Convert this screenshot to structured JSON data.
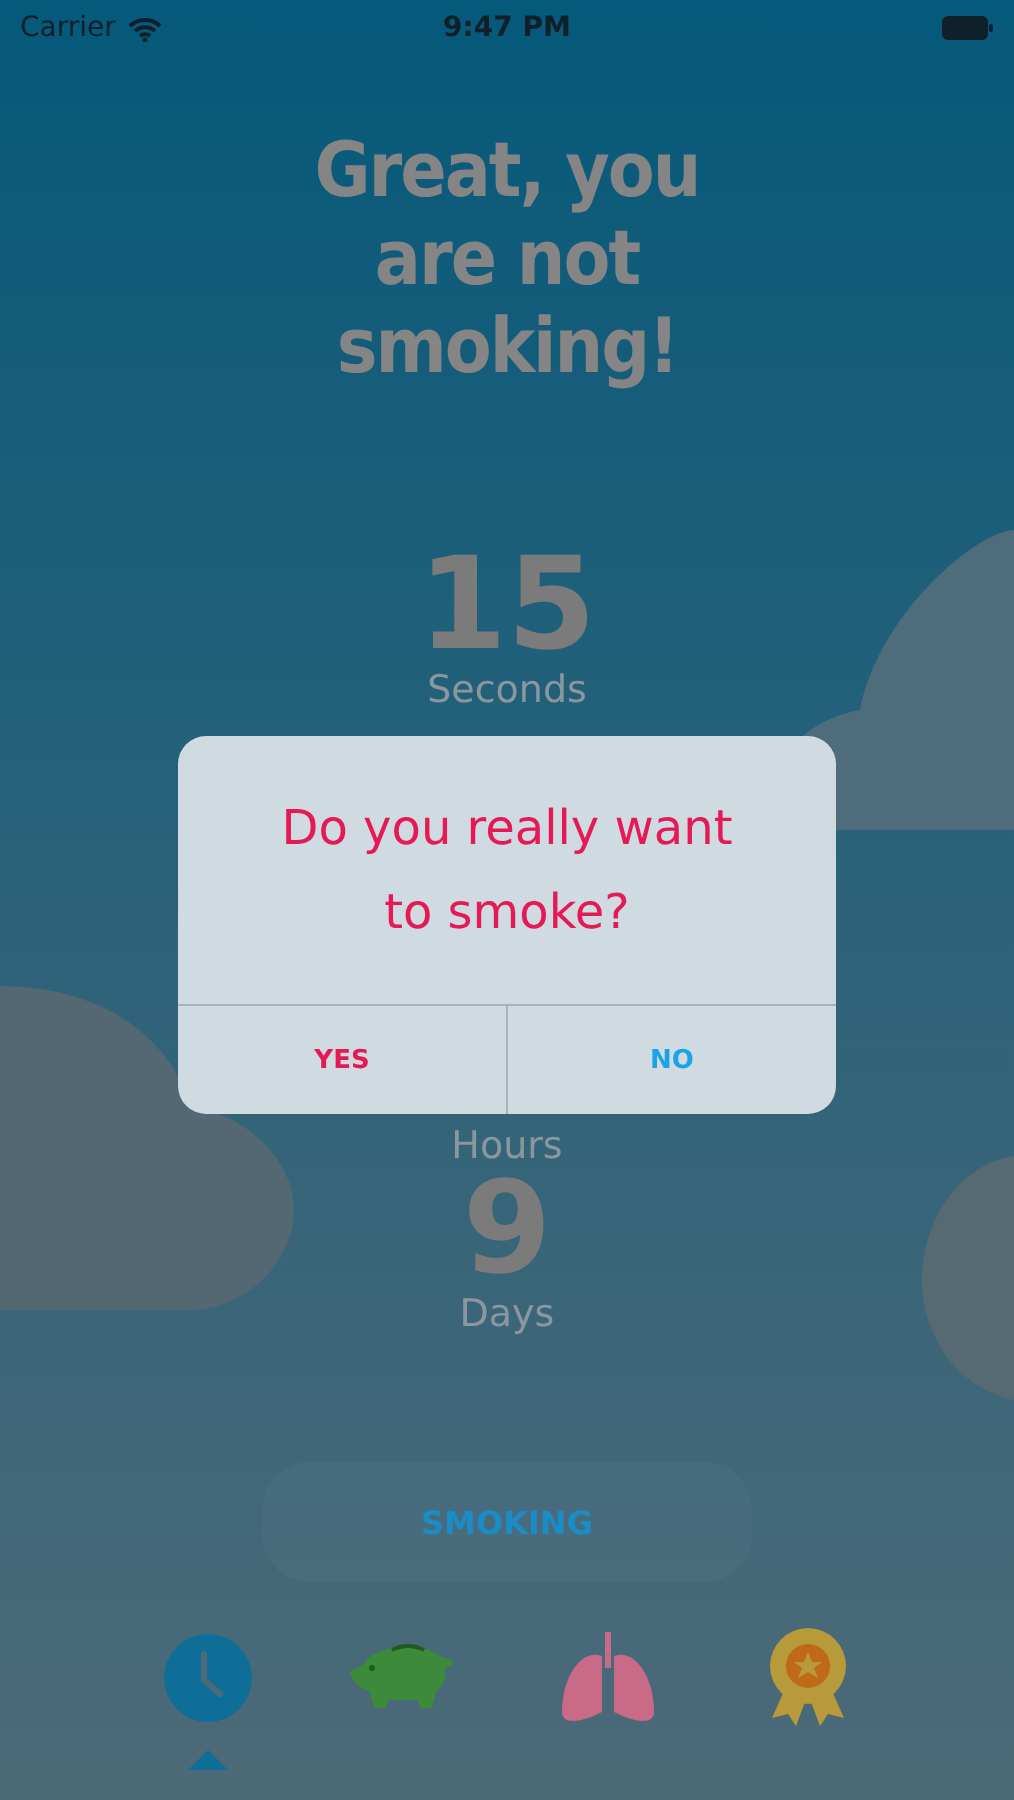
{
  "status_bar": {
    "carrier": "Carrier",
    "time": "9:47 PM"
  },
  "headline": "Great, you are not smoking!",
  "counters": [
    {
      "value": "15",
      "unit": "Seconds"
    },
    {
      "unit": "Hours"
    },
    {
      "value": "9",
      "unit": "Days"
    }
  ],
  "smoking_button": "SMOKING",
  "tabs": [
    {
      "kind": "clock",
      "selected": true
    },
    {
      "kind": "piggy",
      "selected": false
    },
    {
      "kind": "lungs",
      "selected": false
    },
    {
      "kind": "award",
      "selected": false
    }
  ],
  "dialog": {
    "message": "Do you really want to smoke?",
    "buttons": [
      {
        "label": "YES",
        "kind": "confirm"
      },
      {
        "label": "NO",
        "kind": "cancel"
      }
    ]
  }
}
